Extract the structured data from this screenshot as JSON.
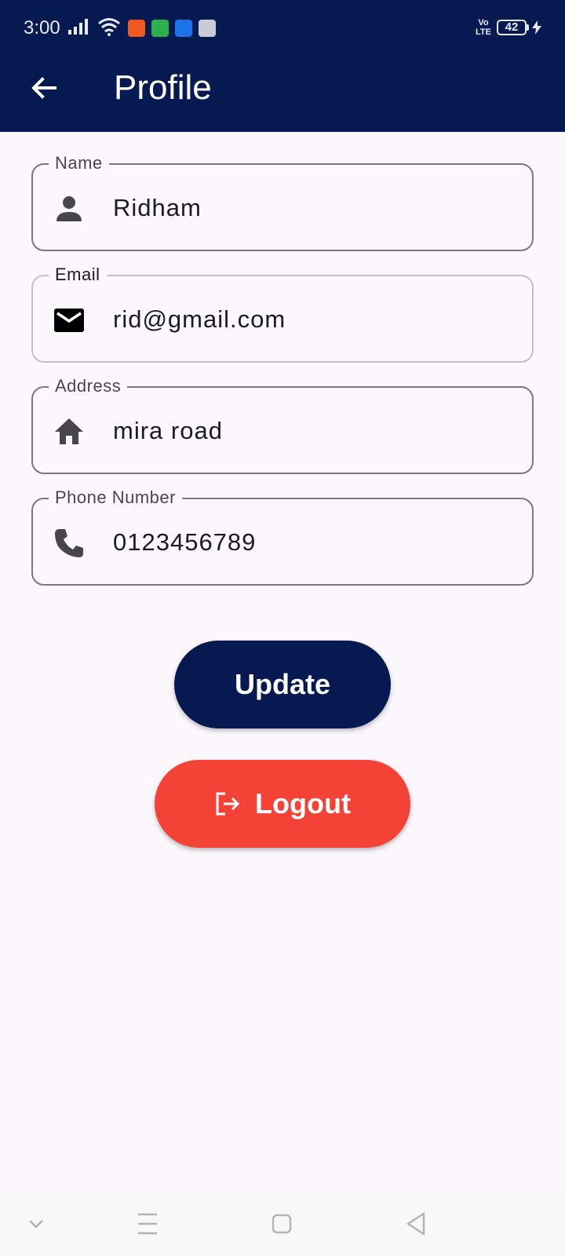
{
  "status_bar": {
    "time": "3:00",
    "volte": "Vo LTE",
    "battery": "42",
    "icons": [
      "signal-icon",
      "wifi-icon",
      "notification-app-icon-orange",
      "notification-app-icon-green",
      "usb-icon",
      "notification-app-icon-gray",
      "charging-icon"
    ]
  },
  "app_bar": {
    "title": "Profile",
    "back_icon": "arrow-back-icon",
    "color": "#071951"
  },
  "form": {
    "name": {
      "label": "Name",
      "value": "Ridham",
      "icon": "person-icon"
    },
    "email": {
      "label": "Email",
      "value": "rid@gmail.com",
      "icon": "mail-icon"
    },
    "address": {
      "label": "Address",
      "value": "mira road",
      "icon": "home-icon"
    },
    "phone": {
      "label": "Phone Number",
      "value": "0123456789",
      "icon": "phone-icon"
    }
  },
  "actions": {
    "update_label": "Update",
    "update_color": "#071951",
    "logout_label": "Logout",
    "logout_icon": "logout-icon",
    "logout_color": "#f44336"
  },
  "nav_bar": {
    "items": [
      "chevron-down-icon",
      "menu-icon",
      "home-square-icon",
      "back-triangle-icon"
    ]
  }
}
